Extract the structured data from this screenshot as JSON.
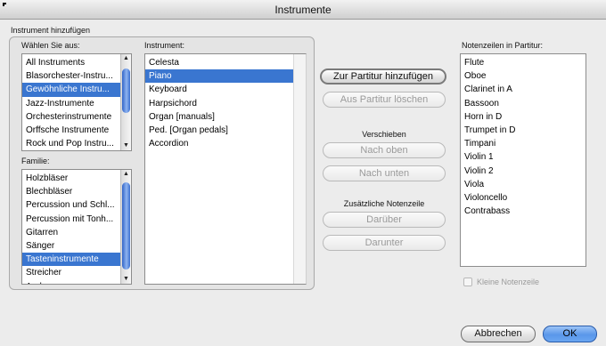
{
  "window": {
    "title": "Instrumente"
  },
  "group": {
    "title": "Instrument hinzufügen"
  },
  "ensemble": {
    "label": "Wählen Sie aus:",
    "items": [
      {
        "label": "All Instruments",
        "selected": false
      },
      {
        "label": "Blasorchester-Instru...",
        "selected": false
      },
      {
        "label": "Gewöhnliche Instru...",
        "selected": true
      },
      {
        "label": "Jazz-Instrumente",
        "selected": false
      },
      {
        "label": "Orchesterinstrumente",
        "selected": false
      },
      {
        "label": "Orffsche Instrumente",
        "selected": false
      },
      {
        "label": "Rock und Pop Instru...",
        "selected": false
      }
    ]
  },
  "family": {
    "label": "Familie:",
    "items": [
      {
        "label": "Holzbläser",
        "selected": false
      },
      {
        "label": "Blechbläser",
        "selected": false
      },
      {
        "label": "Percussion und Schl...",
        "selected": false
      },
      {
        "label": "Percussion mit Tonh...",
        "selected": false
      },
      {
        "label": "Gitarren",
        "selected": false
      },
      {
        "label": "Sänger",
        "selected": false
      },
      {
        "label": "Tasteninstrumente",
        "selected": true
      },
      {
        "label": "Streicher",
        "selected": false
      },
      {
        "label": "Andere",
        "selected": false
      }
    ]
  },
  "instrument": {
    "label": "Instrument:",
    "items": [
      {
        "label": "Celesta",
        "selected": false
      },
      {
        "label": "Piano",
        "selected": true
      },
      {
        "label": "Keyboard",
        "selected": false
      },
      {
        "label": "Harpsichord",
        "selected": false
      },
      {
        "label": "Organ [manuals]",
        "selected": false
      },
      {
        "label": "Ped. [Organ pedals]",
        "selected": false
      },
      {
        "label": "Accordion",
        "selected": false
      }
    ]
  },
  "actions": {
    "add": "Zur Partitur hinzufügen",
    "remove": "Aus Partitur löschen",
    "move_label": "Verschieben",
    "move_up": "Nach oben",
    "move_down": "Nach unten",
    "extra_staff_label": "Zusätzliche Notenzeile",
    "above": "Darüber",
    "below": "Darunter"
  },
  "score": {
    "label": "Notenzeilen in Partitur:",
    "items": [
      "Flute",
      "Oboe",
      "Clarinet in A",
      "Bassoon",
      "Horn in D",
      "Trumpet in D",
      "Timpani",
      "Violin 1",
      "Violin 2",
      "Viola",
      "Violoncello",
      "Contrabass"
    ],
    "small_staff_label": "Kleine Notenzeile",
    "small_staff_checked": false
  },
  "footer": {
    "cancel": "Abbrechen",
    "ok": "OK"
  },
  "icons": {
    "scroll_up": "▲",
    "scroll_down": "▼"
  },
  "colors": {
    "selection": "#3a76d0",
    "primary_button": "#5a97ea"
  }
}
